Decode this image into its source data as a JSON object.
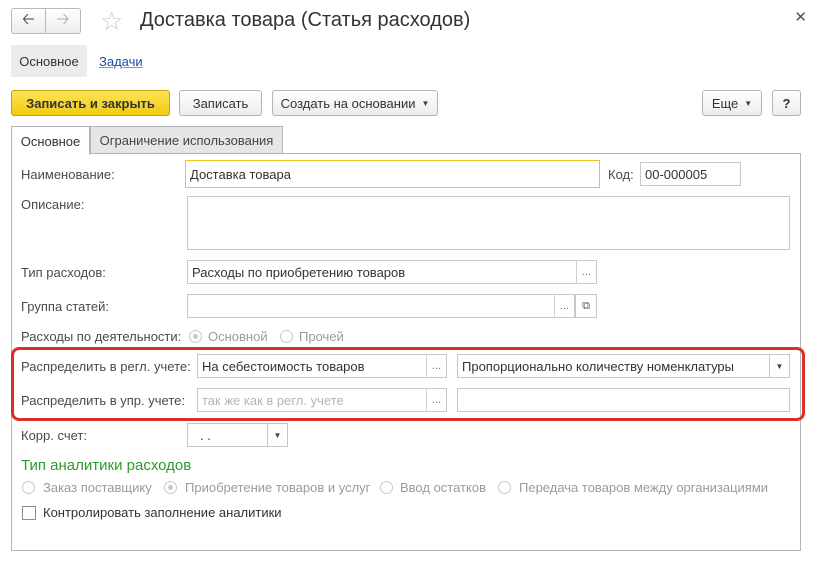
{
  "window": {
    "title": "Доставка товара (Статья расходов)",
    "back_icon": "arrow-left-icon",
    "forward_icon": "arrow-right-icon",
    "favorite_icon": "star-icon",
    "close_icon": "close-icon"
  },
  "panel_tabs": [
    {
      "label": "Основное"
    },
    {
      "label": "Задачи"
    }
  ],
  "toolbar": {
    "save_close": "Записать и закрыть",
    "save": "Записать",
    "create_based": "Создать на основании",
    "more": "Еще",
    "help": "?"
  },
  "form_tabs": [
    {
      "label": "Основное"
    },
    {
      "label": "Ограничение использования"
    }
  ],
  "fields": {
    "name_label": "Наименование:",
    "name_value": "Доставка товара",
    "code_label": "Код:",
    "code_value": "00-000005",
    "description_label": "Описание:",
    "description_value": "",
    "expense_type_label": "Тип расходов:",
    "expense_type_value": "Расходы по приобретению товаров",
    "group_label": "Группа статей:",
    "group_value": "",
    "activity_label": "Расходы по деятельности:",
    "activity_options": [
      {
        "label": "Основной",
        "checked": true
      },
      {
        "label": "Прочей",
        "checked": false
      }
    ],
    "reg_label": "Распределить в регл. учете:",
    "reg_value": "На себестоимость товаров",
    "reg_method_value": "Пропорционально количеству номенклатуры",
    "mgmt_label": "Распределить в упр. учете:",
    "mgmt_placeholder": "так же как в регл. учете",
    "mgmt_method_value": "",
    "account_label": "Корр. счет:",
    "account_value": ". ."
  },
  "analytics": {
    "title": "Тип аналитики расходов",
    "options": [
      {
        "label": "Заказ поставщику",
        "checked": false
      },
      {
        "label": "Приобретение товаров и услуг",
        "checked": true
      },
      {
        "label": "Ввод остатков",
        "checked": false
      },
      {
        "label": "Передача товаров между организациями",
        "checked": false
      }
    ],
    "control_label": "Контролировать заполнение аналитики",
    "control_checked": false
  },
  "colors": {
    "primary_button": "#f2cc10",
    "highlight": "#d9302c",
    "group_title": "#2c9b2c",
    "link": "#1b4ca3"
  }
}
